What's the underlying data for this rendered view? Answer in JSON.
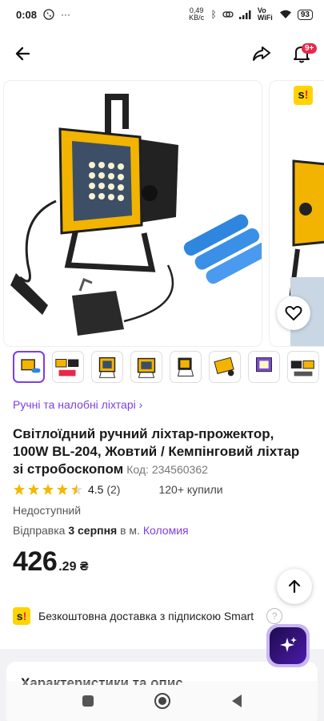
{
  "status_bar": {
    "time": "0:08",
    "net_speed": "0,49 KB/c",
    "wifi_label": "Vo WiFi",
    "battery": "93"
  },
  "header": {
    "notification_badge": "9+"
  },
  "gallery": {
    "thumb_count": 8
  },
  "product": {
    "category": "Ручні та налобні ліхтарі",
    "title": "Світлоїдний ручний ліхтар-прожектор, 100W BL-204, Жовтий / Кемпінговий ліхтар зі стробоскопом",
    "code": "Код: 234560362",
    "rating": "4.5",
    "rating_value": 4.5,
    "review_count": "(2)",
    "purchases": "120+ купили",
    "availability": "Недоступний",
    "shipping_prefix": "Відправка",
    "shipping_date": "3 серпня",
    "shipping_mid": "в м.",
    "shipping_city": "Коломия",
    "price_main": "426",
    "price_cents": ".29 ₴"
  },
  "smart": {
    "logo": "s!",
    "text": "Безкоштовна доставка з підпискою Smart",
    "help": "?"
  },
  "section": {
    "title": "Характеристики та опис"
  },
  "colors": {
    "accent": "#7b3fe4",
    "star": "#f5b800",
    "badge": "#e8284a",
    "smart_yellow": "#ffd400"
  }
}
